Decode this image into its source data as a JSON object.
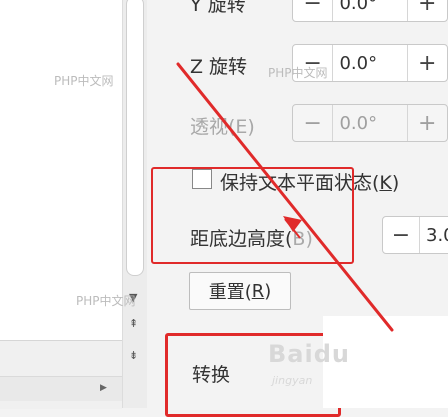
{
  "watermarks": [
    "PHP中文网",
    "PHP中文网",
    "PHP中文网"
  ],
  "rotate_y": {
    "label": "Y 旋转",
    "value": "0.0°"
  },
  "rotate_z": {
    "label": "Z 旋转",
    "value": "0.0°"
  },
  "perspective": {
    "label": "透视(E)",
    "value": "0.0°"
  },
  "keep_flat": {
    "label_prefix": "保持文本平面状态(",
    "mnemonic": "K",
    "label_suffix": ")"
  },
  "distance_bottom": {
    "label": "距底边高度(",
    "label_tail": "B)",
    "value": "3.0"
  },
  "reset": {
    "label_prefix": "重置(",
    "mnemonic": "R",
    "label_suffix": ")"
  },
  "convert": {
    "label": "转换"
  },
  "stepper_symbols": {
    "minus": "−",
    "plus": "+"
  },
  "brand": {
    "logo": "Baidu",
    "sub": "jingyan"
  },
  "colors": {
    "annotation_red": "#e02a2a"
  }
}
